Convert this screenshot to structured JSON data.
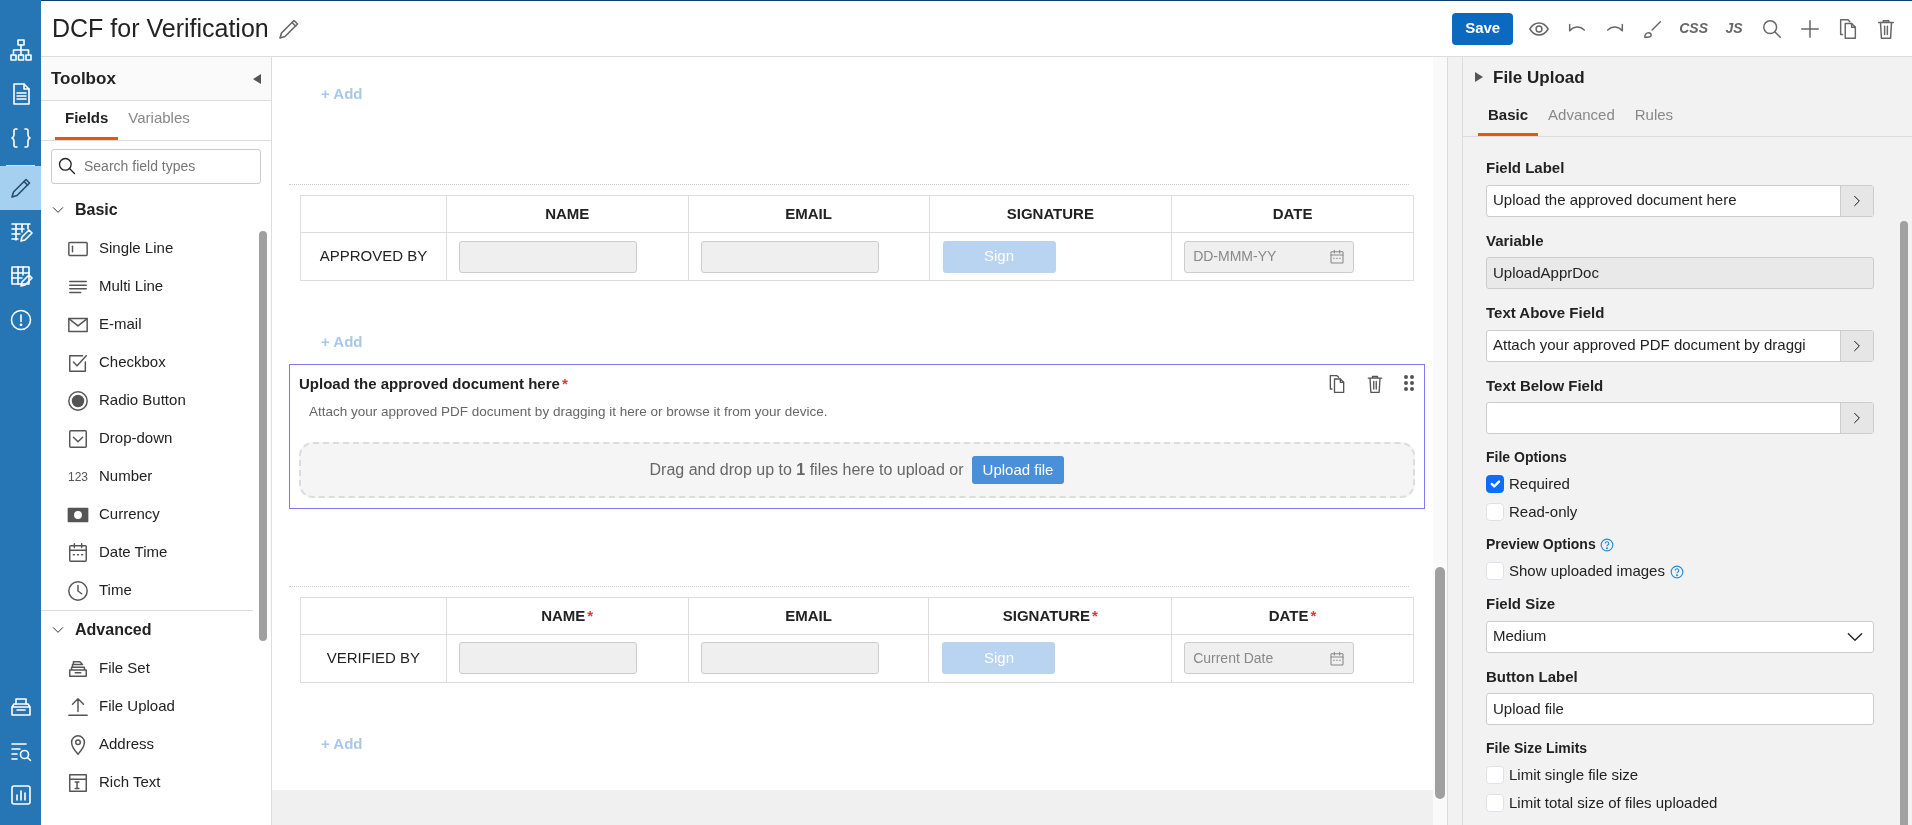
{
  "rail": {
    "top_items": [
      {
        "kind": "hierarchy",
        "selected": false
      },
      {
        "kind": "document",
        "selected": false
      },
      {
        "kind": "braces",
        "selected": false
      },
      {
        "kind": "pencil",
        "selected": true
      },
      {
        "kind": "grid-edit",
        "selected": false
      },
      {
        "kind": "grid-edit2",
        "selected": false
      },
      {
        "kind": "alert",
        "selected": false
      }
    ],
    "bottom_items": [
      {
        "kind": "tray",
        "selected": false
      },
      {
        "kind": "list-search",
        "selected": false
      },
      {
        "kind": "chart",
        "selected": false
      }
    ]
  },
  "header": {
    "title": "DCF for Verification",
    "toolbar": [
      {
        "kind": "save",
        "label": "Save"
      },
      {
        "kind": "eye"
      },
      {
        "kind": "undo"
      },
      {
        "kind": "redo"
      },
      {
        "kind": "brush"
      },
      {
        "kind": "text",
        "label": "CSS"
      },
      {
        "kind": "text",
        "label": "JS"
      },
      {
        "kind": "search"
      },
      {
        "kind": "plus"
      },
      {
        "kind": "copy"
      },
      {
        "kind": "trash"
      }
    ]
  },
  "toolbox": {
    "title": "Toolbox",
    "tabs": [
      {
        "label": "Fields",
        "selected": true
      },
      {
        "label": "Variables",
        "selected": false
      }
    ],
    "search": {
      "placeholder": "Search field types"
    },
    "groups": [
      {
        "title": "Basic",
        "expanded": true,
        "items": [
          {
            "label": "Single Line",
            "kind": "single-line"
          },
          {
            "label": "Multi Line",
            "kind": "multi-line"
          },
          {
            "label": "E-mail",
            "kind": "email"
          },
          {
            "label": "Checkbox",
            "kind": "checkbox"
          },
          {
            "label": "Radio Button",
            "kind": "radio"
          },
          {
            "label": "Drop-down",
            "kind": "dropdown"
          },
          {
            "label": "Number",
            "kind": "number",
            "glyph": "123"
          },
          {
            "label": "Currency",
            "kind": "currency"
          },
          {
            "label": "Date Time",
            "kind": "datetime"
          },
          {
            "label": "Time",
            "kind": "time"
          }
        ]
      },
      {
        "title": "Advanced",
        "expanded": true,
        "items": [
          {
            "label": "File Set",
            "kind": "fileset"
          },
          {
            "label": "File Upload",
            "kind": "upload"
          },
          {
            "label": "Address",
            "kind": "address"
          },
          {
            "label": "Rich Text",
            "kind": "richtext"
          }
        ]
      }
    ]
  },
  "canvas": {
    "sections": [
      {
        "kind": "add",
        "label": "+ Add"
      },
      {
        "kind": "table",
        "columns": [
          {
            "label": "NAME"
          },
          {
            "label": "EMAIL"
          },
          {
            "label": "SIGNATURE"
          },
          {
            "label": "DATE"
          }
        ],
        "row_label": "APPROVED BY",
        "cells": [
          {
            "kind": "input"
          },
          {
            "kind": "input"
          },
          {
            "kind": "sign",
            "label": "Sign"
          },
          {
            "kind": "date",
            "placeholder": "DD-MMM-YY"
          }
        ]
      },
      {
        "kind": "add",
        "label": "+ Add"
      },
      {
        "kind": "upload",
        "selected": true,
        "label": "Upload the approved document here",
        "required_mark": "*",
        "help": "Attach your approved PDF document by dragging it here or browse it from your device.",
        "drop_text": "Drag and drop up to **1** files here to upload or",
        "button": "Upload file"
      },
      {
        "kind": "table",
        "columns": [
          {
            "label": "NAME",
            "required_mark": "*"
          },
          {
            "label": "EMAIL"
          },
          {
            "label": "SIGNATURE",
            "required_mark": "*"
          },
          {
            "label": "DATE",
            "required_mark": "*"
          }
        ],
        "row_label": "VERIFIED BY",
        "cells": [
          {
            "kind": "input"
          },
          {
            "kind": "input"
          },
          {
            "kind": "sign",
            "label": "Sign"
          },
          {
            "kind": "date",
            "placeholder": "Current Date"
          }
        ]
      },
      {
        "kind": "add",
        "label": "+ Add"
      }
    ]
  },
  "properties": {
    "title": "File Upload",
    "tabs": [
      {
        "label": "Basic",
        "selected": true
      },
      {
        "label": "Advanced",
        "selected": false
      },
      {
        "label": "Rules",
        "selected": false
      }
    ],
    "fields": [
      {
        "kind": "expand",
        "label": "Field Label",
        "value": "Upload the approved document here"
      },
      {
        "kind": "readonly",
        "label": "Variable",
        "value": "UploadApprDoc"
      },
      {
        "kind": "expand",
        "label": "Text Above Field",
        "value": "Attach your approved PDF document by draggi"
      },
      {
        "kind": "expand",
        "label": "Text Below Field"
      },
      {
        "kind": "checks",
        "label": "File Options",
        "options": [
          {
            "label": "Required",
            "checked": true
          },
          {
            "label": "Read-only",
            "checked": false
          }
        ]
      },
      {
        "kind": "checks",
        "label": "Preview Options",
        "help": true,
        "options": [
          {
            "label": "Show uploaded images",
            "checked": false,
            "help": true
          }
        ]
      },
      {
        "kind": "select",
        "label": "Field Size",
        "value": "Medium"
      },
      {
        "kind": "text",
        "label": "Button Label",
        "value": "Upload file"
      },
      {
        "kind": "checks",
        "label": "File Size Limits",
        "options": [
          {
            "label": "Limit single file size",
            "checked": false
          },
          {
            "label": "Limit total size of files uploaded",
            "checked": false
          }
        ]
      }
    ]
  }
}
